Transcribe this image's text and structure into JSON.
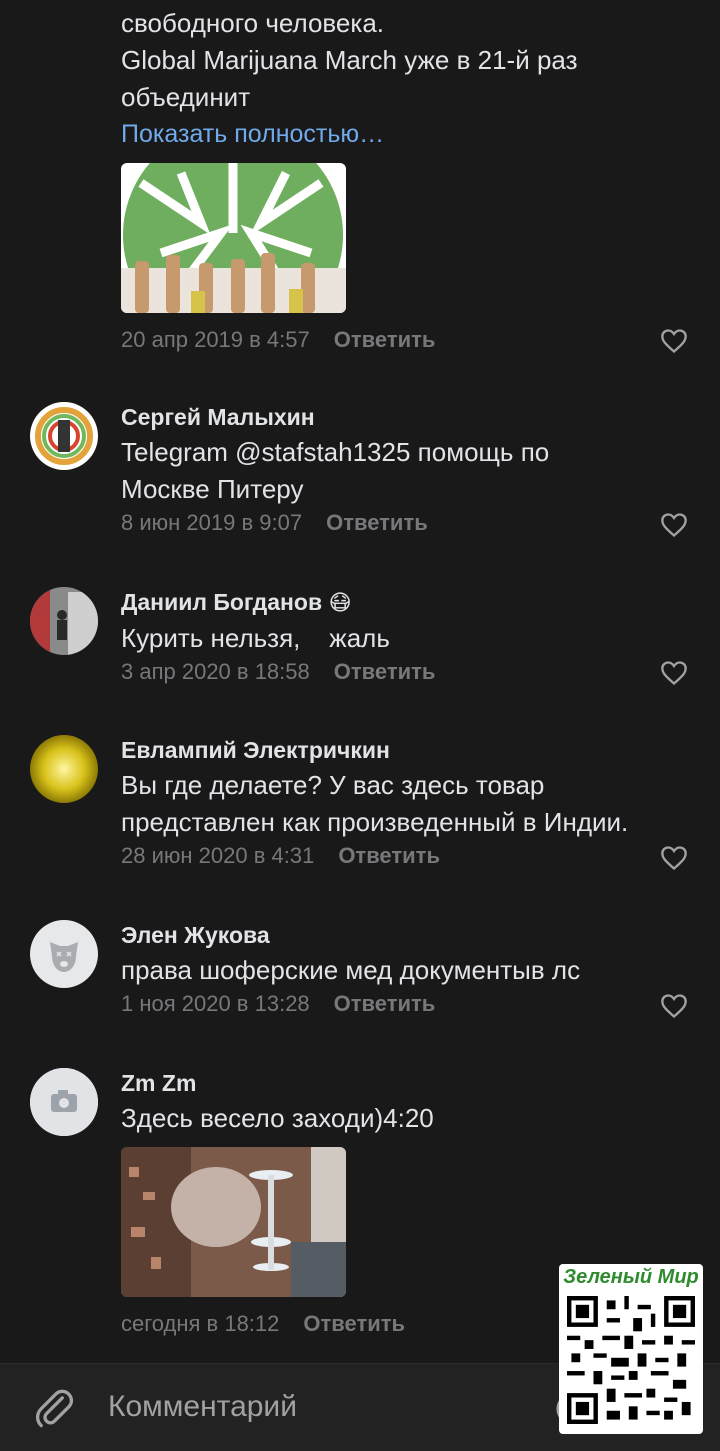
{
  "post": {
    "text_lines": [
      "свободного человека.",
      "Global Marijuana March уже в 21-й раз",
      "объединит"
    ],
    "show_more": "Показать полностью…",
    "date": "20 апр 2019 в 4:57",
    "reply": "Ответить"
  },
  "comments": [
    {
      "author": "Сергей Малыхин",
      "text": [
        "Telegram @stafstah1325 помощь по",
        "Москве Питеру"
      ],
      "date": "8 июн 2019 в 9:07",
      "reply": "Ответить"
    },
    {
      "author": "Даниил Богданов",
      "emoji": "😷",
      "text": [
        "Курить нельзя,    жаль"
      ],
      "date": "3 апр 2020 в 18:58",
      "reply": "Ответить"
    },
    {
      "author": "Евлампий Электричкин",
      "text": [
        "Вы где делаете? У вас здесь товар",
        "представлен как произведенный в Индии."
      ],
      "date": "28 июн 2020 в 4:31",
      "reply": "Ответить"
    },
    {
      "author": "Элен Жукова",
      "text": [
        "права шоферские мед документыв лс"
      ],
      "date": "1 ноя 2020 в 13:28",
      "reply": "Ответить"
    },
    {
      "author": "Zm Zm",
      "text": [
        "Здесь весело заходи)4:20"
      ],
      "date": "сегодня в 18:12",
      "reply": "Ответить"
    }
  ],
  "composer": {
    "placeholder": "Комментарий"
  },
  "watermark": {
    "title": "Зеленый Мир"
  },
  "colors": {
    "background": "#19191a",
    "link": "#71aaeb",
    "muted": "#76787a",
    "text": "#e1e3e6"
  }
}
